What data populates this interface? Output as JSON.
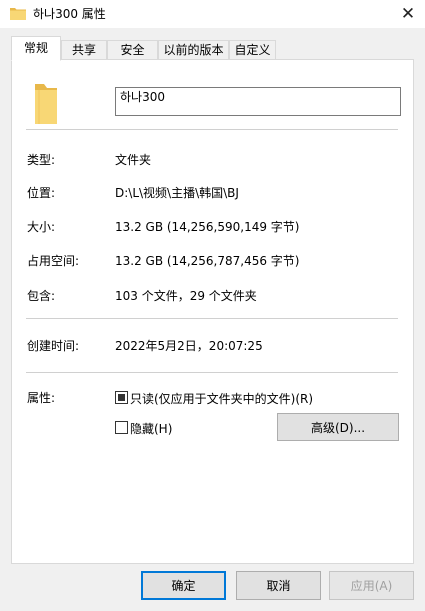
{
  "window": {
    "title": "하나300 属性",
    "close": "✕"
  },
  "tabs": [
    {
      "label": "常规",
      "active": true
    },
    {
      "label": "共享"
    },
    {
      "label": "安全"
    },
    {
      "label": "以前的版本"
    },
    {
      "label": "自定义"
    }
  ],
  "general": {
    "name_value": "하나300",
    "props": [
      {
        "label": "类型:",
        "value": "文件夹"
      },
      {
        "label": "位置:",
        "value": "D:\\L\\视频\\主播\\韩国\\BJ"
      },
      {
        "label": "大小:",
        "value": "13.2 GB (14,256,590,149 字节)"
      },
      {
        "label": "占用空间:",
        "value": "13.2 GB (14,256,787,456 字节)"
      },
      {
        "label": "包含:",
        "value": "103 个文件，29 个文件夹"
      },
      {
        "label": "创建时间:",
        "value": "2022年5月2日，20:07:25"
      }
    ],
    "attributes_label": "属性:",
    "readonly_label": "只读(仅应用于文件夹中的文件)(R)",
    "hidden_label": "隐藏(H)",
    "advanced_label": "高级(D)..."
  },
  "buttons": {
    "ok": "确定",
    "cancel": "取消",
    "apply": "应用(A)"
  },
  "colors": {
    "folder": "#f8d775",
    "accent": "#0078d7"
  }
}
